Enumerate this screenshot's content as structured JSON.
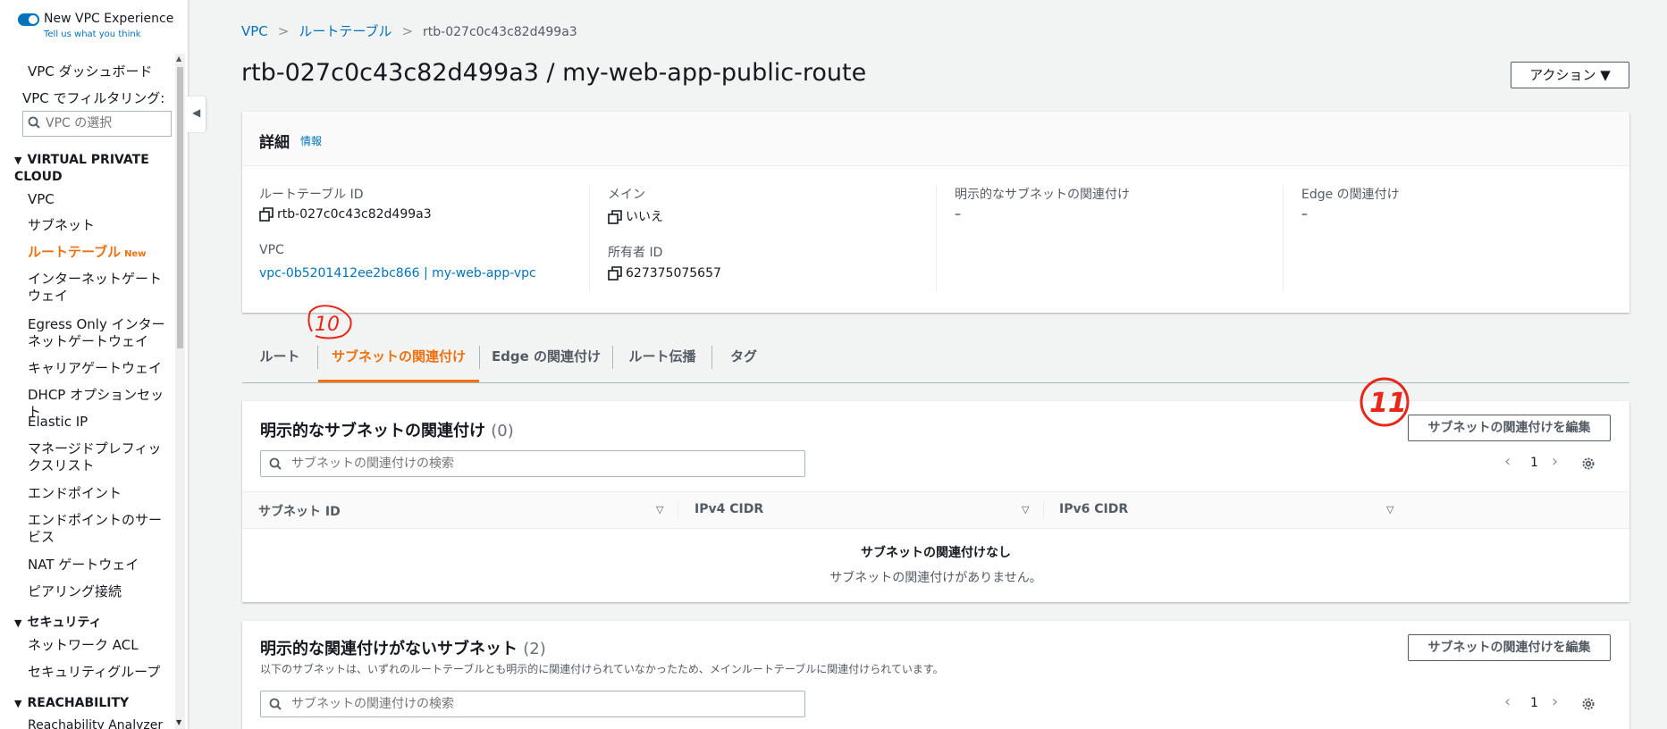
{
  "sidebar": {
    "experience_title": "New VPC Experience",
    "experience_sub": "Tell us what you think",
    "dashboard": "VPC ダッシュボード",
    "filter_label": "VPC でフィルタリング:",
    "filter_placeholder": "VPC の選択",
    "section_vpc": "VIRTUAL PRIVATE CLOUD",
    "items_vpc": [
      "VPC",
      "サブネット",
      "ルートテーブル",
      "インターネットゲートウェイ",
      "Egress Only インターネットゲートウェイ",
      "キャリアゲートウェイ",
      "DHCP オプションセット",
      "Elastic IP",
      "マネージドプレフィックスリスト",
      "エンドポイント",
      "エンドポイントのサービス",
      "NAT ゲートウェイ",
      "ピアリング接続"
    ],
    "new_badge": "New",
    "section_security": "セキュリティ",
    "items_security": [
      "ネットワーク ACL",
      "セキュリティグループ"
    ],
    "section_reach": "REACHABILITY",
    "items_reach": [
      "Reachability Analyzer"
    ]
  },
  "breadcrumb": {
    "root": "VPC",
    "parent": "ルートテーブル",
    "current": "rtb-027c0c43c82d499a3"
  },
  "page_title": "rtb-027c0c43c82d499a3 / my-web-app-public-route",
  "action_button": "アクション ▼",
  "details": {
    "header": "詳細",
    "info": "情報",
    "rt_id_label": "ルートテーブル ID",
    "rt_id_value": "rtb-027c0c43c82d499a3",
    "vpc_label": "VPC",
    "vpc_value": "vpc-0b5201412ee2bc866 | my-web-app-vpc",
    "main_label": "メイン",
    "main_value": "いいえ",
    "owner_label": "所有者 ID",
    "owner_value": "627375075657",
    "explicit_label": "明示的なサブネットの関連付け",
    "explicit_value": "–",
    "edge_label": "Edge の関連付け",
    "edge_value": "–"
  },
  "tabs": [
    "ルート",
    "サブネットの関連付け",
    "Edge の関連付け",
    "ルート伝播",
    "タグ"
  ],
  "section1": {
    "title": "明示的なサブネットの関連付け",
    "count": "(0)",
    "edit_button": "サブネットの関連付けを編集",
    "search_placeholder": "サブネットの関連付けの検索",
    "page": "1",
    "columns": [
      "サブネット ID",
      "IPv4 CIDR",
      "IPv6 CIDR"
    ],
    "empty_title": "サブネットの関連付けなし",
    "empty_desc": "サブネットの関連付けがありません。"
  },
  "section2": {
    "title": "明示的な関連付けがないサブネット",
    "count": "(2)",
    "desc": "以下のサブネットは、いずれのルートテーブルとも明示的に関連付けられていなかったため、メインルートテーブルに関連付けられています。",
    "edit_button": "サブネットの関連付けを編集",
    "search_placeholder": "サブネットの関連付けの検索",
    "page": "1"
  },
  "annotations": [
    "10",
    "11"
  ],
  "colors": {
    "accent": "#ec7211",
    "link": "#0073bb",
    "annotation": "#e8261a"
  }
}
